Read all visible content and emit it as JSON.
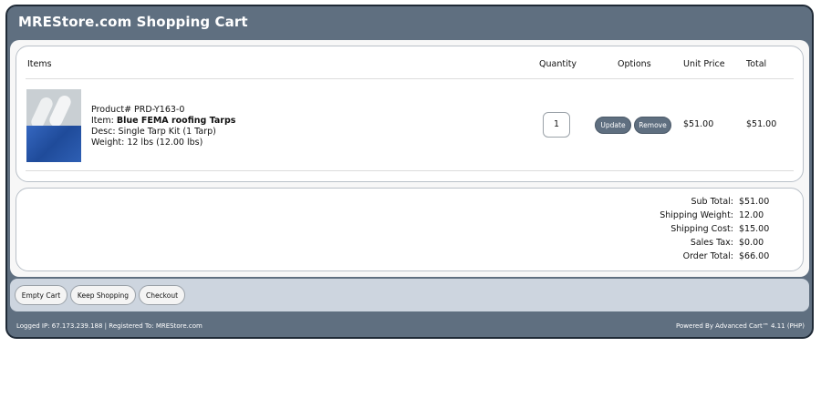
{
  "header": {
    "title": "MREStore.com Shopping Cart"
  },
  "table": {
    "headers": {
      "items": "Items",
      "quantity": "Quantity",
      "options": "Options",
      "unit_price": "Unit Price",
      "total": "Total"
    }
  },
  "item": {
    "product_number": "Product# PRD-Y163-0",
    "item_prefix": "Item: ",
    "item_name": "Blue FEMA roofing Tarps",
    "desc": "Desc: Single Tarp Kit (1 Tarp)",
    "weight": "Weight: 12 lbs (12.00 lbs)",
    "quantity": "1",
    "update_label": "Update",
    "remove_label": "Remove",
    "unit_price": "$51.00",
    "total": "$51.00"
  },
  "totals": {
    "subtotal_label": "Sub Total:",
    "subtotal": "$51.00",
    "ship_weight_label": "Shipping Weight:",
    "ship_weight": "12.00",
    "ship_cost_label": "Shipping Cost:",
    "ship_cost": "$15.00",
    "tax_label": "Sales Tax:",
    "tax": "$0.00",
    "order_total_label": "Order Total:",
    "order_total": "$66.00"
  },
  "actions": {
    "empty_cart": "Empty Cart",
    "keep_shopping": "Keep Shopping",
    "checkout": "Checkout"
  },
  "footer": {
    "left": "Logged IP: 67.173.239.188 | Registered To: MREStore.com",
    "right": "Powered By Advanced Cart™ 4.11 (PHP)"
  },
  "colors": {
    "frame": "#5f6f80",
    "action_bar": "#cdd5df"
  }
}
